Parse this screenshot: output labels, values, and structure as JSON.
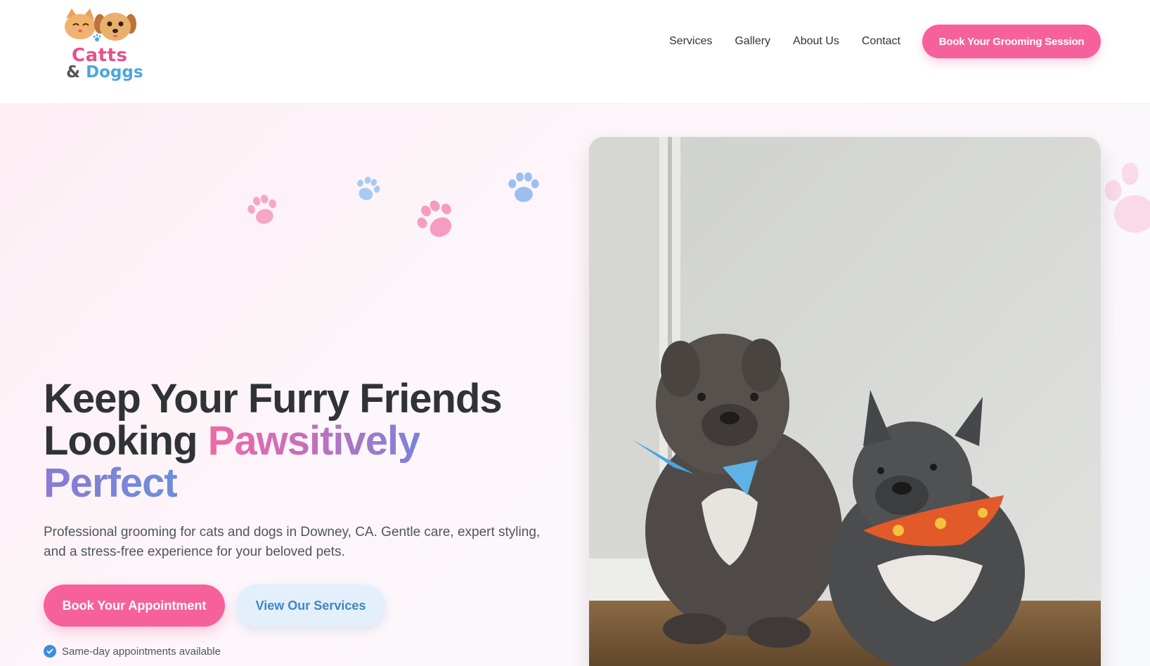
{
  "brand": {
    "line1": "Catts",
    "line2_amp": "&",
    "line2": "Doggs",
    "colors": {
      "pink": "#f7619b",
      "blue": "#4aa6e0"
    }
  },
  "nav": {
    "items": [
      "Services",
      "Gallery",
      "About Us",
      "Contact"
    ],
    "cta": "Book Your Grooming Session"
  },
  "hero": {
    "title_plain_1": "Keep Your Furry Friends",
    "title_plain_2": "Looking ",
    "title_highlight_1": "Pawsitively",
    "title_highlight_2": "Perfect",
    "subtitle": "Professional grooming for cats and dogs in Downey, CA. Gentle care, expert styling, and a stress-free experience for your beloved pets.",
    "primary_button": "Book Your Appointment",
    "secondary_button": "View Our Services",
    "perk": "Same-day appointments available"
  },
  "icons": [
    "paw-print-icon",
    "check-circle-icon",
    "cat-face-icon",
    "dog-face-icon"
  ]
}
